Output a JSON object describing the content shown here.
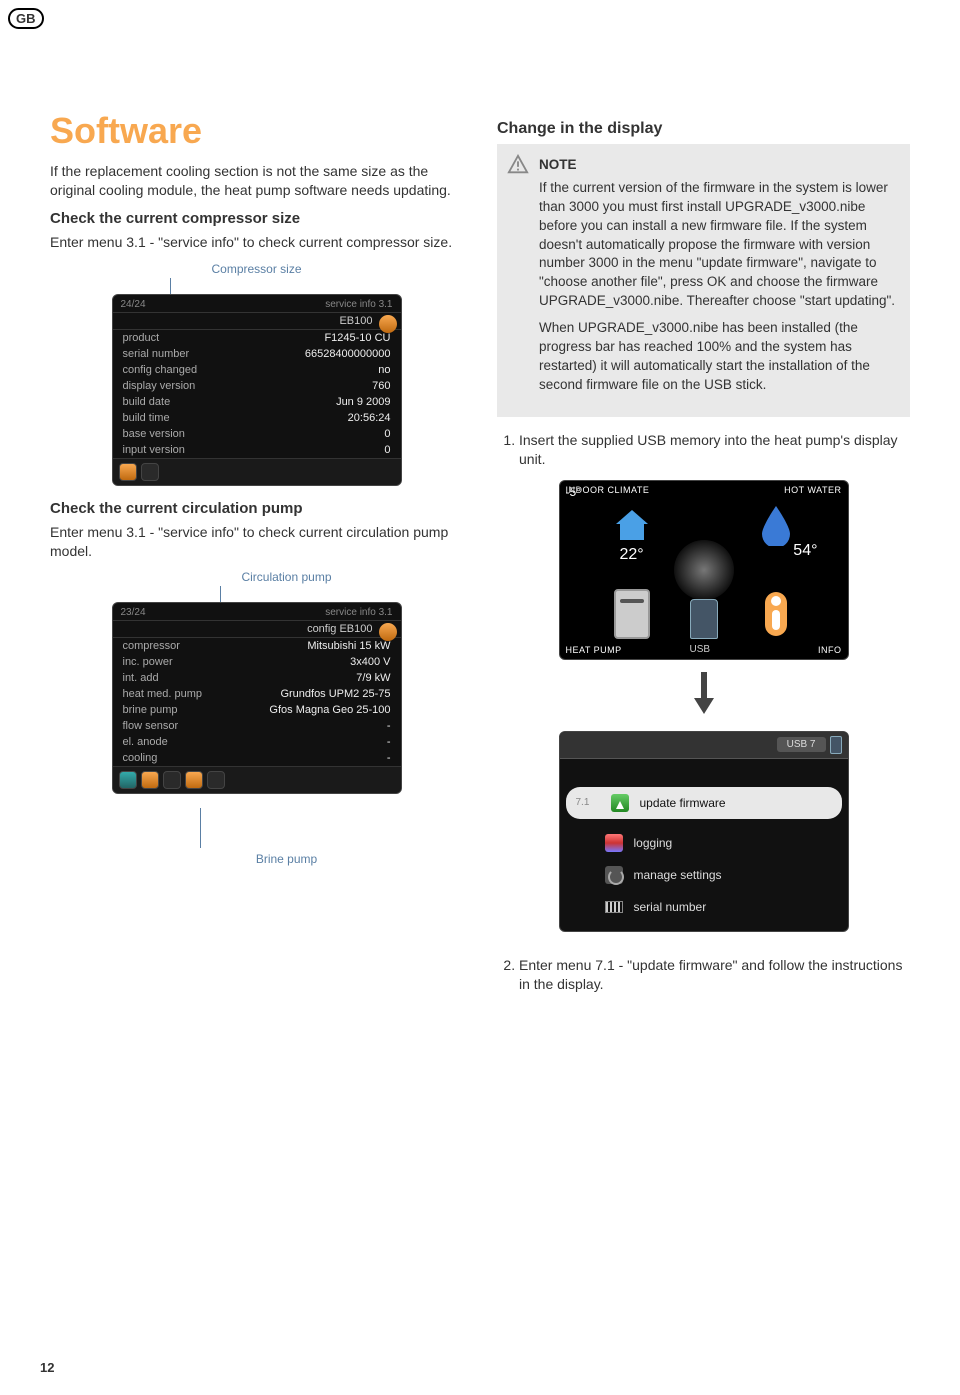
{
  "badge": "GB",
  "page_number": "12",
  "left": {
    "title": "Software",
    "intro": "If the replacement cooling section is not the same size as the original cooling module, the heat pump software needs updating.",
    "check_comp_head": "Check the current compressor size",
    "check_comp_text": "Enter menu 3.1 - \"service info\" to check current compressor size.",
    "callout_comp": "Compressor size",
    "check_circ_head": "Check the current circulation pump",
    "check_circ_text": "Enter menu 3.1 - \"service info\" to check current circulation pump model.",
    "callout_circ": "Circulation pump",
    "callout_brine": "Brine pump"
  },
  "screen1": {
    "counter": "24/24",
    "title": "service info 3.1",
    "sub": "EB100",
    "rows": [
      [
        "product",
        "F1245-10 CU"
      ],
      [
        "serial number",
        "66528400000000"
      ],
      [
        "config changed",
        "no"
      ],
      [
        "display version",
        "760"
      ],
      [
        "build date",
        "Jun 9 2009"
      ],
      [
        "build time",
        "20:56:24"
      ],
      [
        "base version",
        "0"
      ],
      [
        "input version",
        "0"
      ]
    ]
  },
  "screen2": {
    "counter": "23/24",
    "title": "service info 3.1",
    "sub": "config EB100",
    "rows": [
      [
        "compressor",
        "Mitsubishi 15 kW"
      ],
      [
        "inc. power",
        "3x400 V"
      ],
      [
        "int. add",
        "7/9 kW"
      ],
      [
        "heat med. pump",
        "Grundfos UPM2 25-75"
      ],
      [
        "brine pump",
        "Gfos Magna Geo 25-100"
      ],
      [
        "flow sensor",
        "-"
      ],
      [
        "el. anode",
        "-"
      ],
      [
        "cooling",
        "-"
      ]
    ]
  },
  "right": {
    "title": "Change in the display",
    "note_head": "NOTE",
    "note_p1": "If the current version of the firmware in the system is lower than 3000 you must first install UPGRADE_v3000.nibe before you can install a new firmware file. If the system doesn't automatically propose the firmware with version number 3000 in the menu \"update firmware\", navigate to \"choose another file\", press OK and choose the firmware UPGRADE_v3000.nibe. Thereafter choose \"start updating\".",
    "note_p2": "When UPGRADE_v3000.nibe has been installed (the progress bar has reached 100% and the system has restarted) it will automatically start the installation of the second firmware file on the USB stick.",
    "step1": "Insert the supplied USB memory into the heat pump's display unit.",
    "step2": "Enter menu 7.1 - \"update firmware\" and follow the instructions in the display."
  },
  "mainmenu": {
    "tl": "INDOOR CLIMATE",
    "tr": "HOT WATER",
    "bl": "HEAT PUMP",
    "br": "INFO",
    "outdoor": "-5°",
    "indoor": "22°",
    "hotwater": "54°",
    "usb": "USB"
  },
  "usbmenu": {
    "tab": "USB 7",
    "num": "7.1",
    "items": [
      "update firmware",
      "logging",
      "manage settings",
      "serial number"
    ]
  }
}
